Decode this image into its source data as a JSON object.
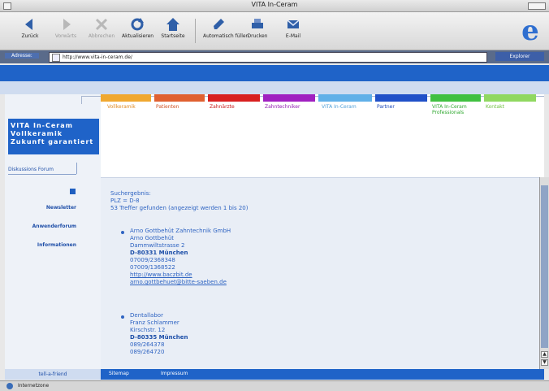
{
  "window": {
    "title": "VITA In-Ceram"
  },
  "toolbar": {
    "buttons": [
      {
        "label": "Zurück"
      },
      {
        "label": "Vorwärts"
      },
      {
        "label": "Abbrechen"
      },
      {
        "label": "Aktualisieren"
      },
      {
        "label": "Startseite"
      },
      {
        "label": "Automatisch füllen"
      },
      {
        "label": "Drucken"
      },
      {
        "label": "E-Mail"
      }
    ]
  },
  "address": {
    "label": "Adresse:",
    "value": "http://www.vita-in-ceram.de/",
    "go": "Explorer"
  },
  "nav": {
    "tabs": [
      {
        "label": "Vollkeramik",
        "color": "#f0a830"
      },
      {
        "label": "Patienten",
        "color": "#e06030"
      },
      {
        "label": "Zahnärzte",
        "color": "#d82020"
      },
      {
        "label": "Zahntechniker",
        "color": "#a020c0"
      },
      {
        "label": "VITA In-Ceram",
        "color": "#60b0e8"
      },
      {
        "label": "Partner",
        "color": "#2050c8"
      },
      {
        "label": "VITA In-Ceram Professionals",
        "color": "#40c040"
      },
      {
        "label": "Kontakt",
        "color": "#90d860"
      }
    ]
  },
  "sidebar": {
    "logo_lines": [
      "VITA In-Ceram",
      "Vollkeramik",
      "Zukunft garantiert"
    ],
    "forum": "Diskussions Forum",
    "links": [
      "Newsletter",
      "Anwenderforum",
      "Informationen"
    ]
  },
  "results": {
    "heading": "Suchergebnis:",
    "query": "PLZ = D-8",
    "count": "53 Treffer gefunden (angezeigt werden 1 bis 20)",
    "entries": [
      {
        "name": "Arno Gottbehüt Zahntechnik GmbH",
        "contact": "Arno Gottbehüt",
        "street": "Dammwiltstrasse 2",
        "city": "D-80331   München",
        "phone": "07009/2368348",
        "fax": "07009/1368522",
        "web": "http://www.baczbit.de",
        "email": "arno.gottbehuet@bitte-saeben.de"
      },
      {
        "name": "Dentallabor",
        "contact": "Franz Schlammer",
        "street": "Kirschstr. 12",
        "city": "D-80335   München",
        "phone": "089/264378",
        "fax": "089/264720"
      }
    ]
  },
  "footer": {
    "tell": "tell-a-friend",
    "links": [
      "Sitemap",
      "Impressum"
    ]
  },
  "status": {
    "text": "Internetzone"
  }
}
